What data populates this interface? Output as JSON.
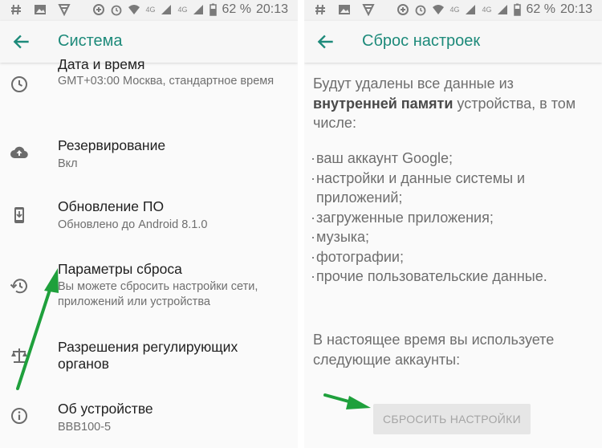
{
  "statusbar": {
    "network_top": "4G",
    "network_bottom": "4G",
    "battery": "62 %",
    "time": "20:13"
  },
  "left_screen": {
    "title": "Система",
    "items": [
      {
        "title": "Дата и время",
        "subtitle": "GMT+03:00 Москва, стандартное время",
        "icon": "clock-icon"
      },
      {
        "title": "Резервирование",
        "subtitle": "Вкл",
        "icon": "cloud-upload-icon"
      },
      {
        "title": "Обновление ПО",
        "subtitle": "Обновлено до Android 8.1.0",
        "icon": "system-update-icon"
      },
      {
        "title": "Параметры сброса",
        "subtitle": "Вы можете сбросить настройки сети, приложений или устройства",
        "icon": "restore-icon"
      },
      {
        "title": "Разрешения регулирующих органов",
        "subtitle": "",
        "icon": "scales-icon"
      },
      {
        "title": "Об устройстве",
        "subtitle": "BBB100-5",
        "icon": "info-icon"
      }
    ]
  },
  "right_screen": {
    "title": "Сброс настроек",
    "intro_part1": "Будут удалены все данные из",
    "intro_bold": "внутренней памяти",
    "intro_part2": "устройства, в том числе:",
    "bullets": [
      "ваш аккаунт Google;",
      "настройки и данные системы и приложений;",
      "загруженные приложения;",
      "музыка;",
      "фотографии;",
      "прочие пользовательские данные."
    ],
    "accounts_note": "В настоящее время вы используете следующие аккаунты:",
    "reset_button": "СБРОСИТЬ НАСТРОЙКИ"
  },
  "colors": {
    "accent": "#1d8a7a",
    "annotation_arrow": "#1fa03c"
  }
}
